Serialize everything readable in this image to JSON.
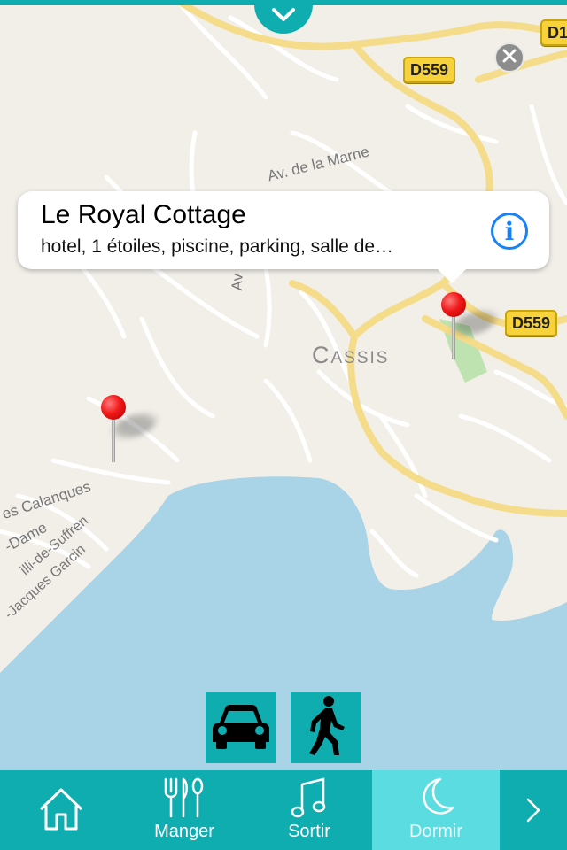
{
  "map": {
    "labels": {
      "town": "Cassis",
      "street_marne": "Av. de la Marne",
      "street_av": "Av",
      "street_calanques": "es Calanques",
      "street_dame": "-Dame",
      "street_suffren": "illi-de-Suffren",
      "street_garcin": "-Jacques Garcin"
    },
    "road_shields": [
      "D559",
      "D559",
      "D1"
    ],
    "colors": {
      "land": "#f2efe9",
      "water": "#a9d3e6",
      "road": "#ffffff",
      "major_road": "#f5dc8a",
      "park": "#bfe3b0",
      "accent": "#10adb0",
      "pin": "#f01818"
    }
  },
  "callout": {
    "title": "Le Royal Cottage",
    "subtitle": "hotel, 1 étoiles, piscine, parking, salle de…"
  },
  "transport_modes": [
    "car-icon",
    "walking-icon"
  ],
  "tabs": [
    {
      "label": "",
      "icon": "home-icon"
    },
    {
      "label": "Manger",
      "icon": "fork-knife-icon"
    },
    {
      "label": "Sortir",
      "icon": "music-note-icon"
    },
    {
      "label": "Dormir",
      "icon": "moon-icon",
      "active": true
    },
    {
      "label": "",
      "icon": "chevron-right-icon"
    }
  ]
}
